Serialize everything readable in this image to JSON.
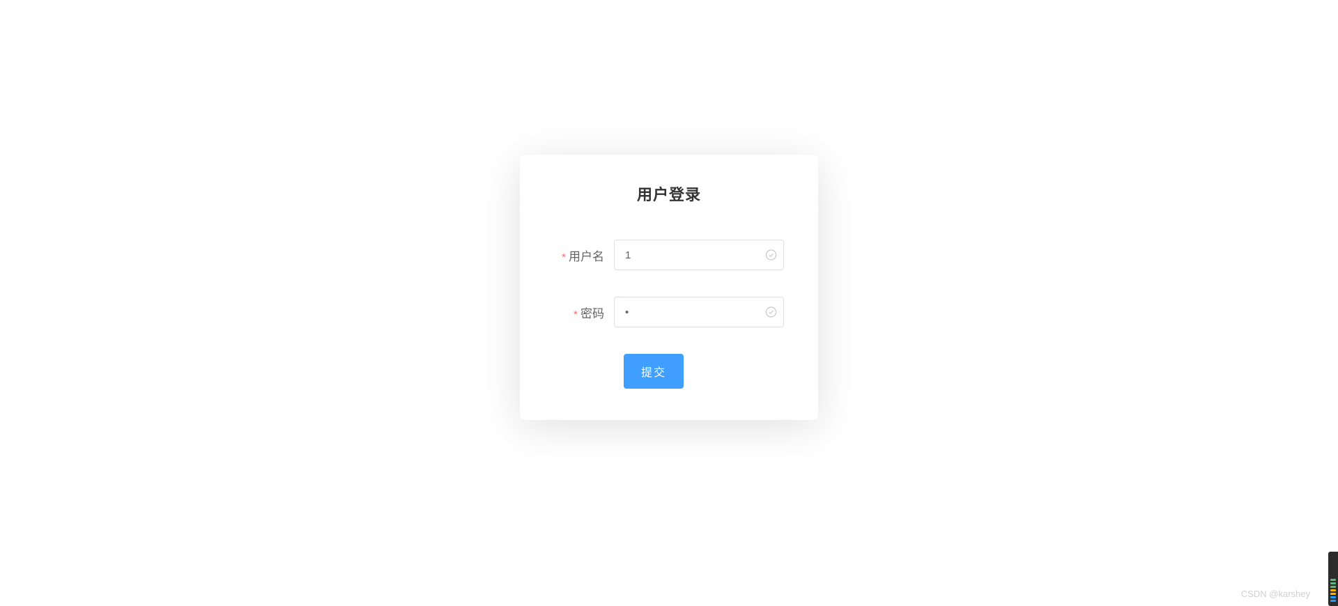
{
  "title": "用户登录",
  "form": {
    "username": {
      "label": "用户名",
      "value": "1",
      "required": true
    },
    "password": {
      "label": "密码",
      "value": "1",
      "required": true
    },
    "submit_label": "提交"
  },
  "watermark": "CSDN @karshey",
  "required_marker": "*"
}
